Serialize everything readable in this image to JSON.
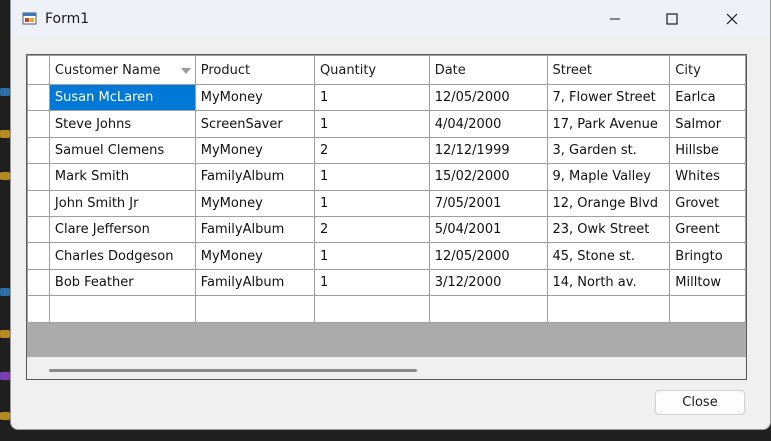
{
  "window": {
    "title": "Form1",
    "close_button_label": "Close"
  },
  "grid": {
    "columns": [
      "Customer Name",
      "Product",
      "Quantity",
      "Date",
      "Street",
      "City"
    ],
    "rows": [
      [
        "Susan McLaren",
        "MyMoney",
        "1",
        "12/05/2000",
        "7, Flower Street",
        "Earlca"
      ],
      [
        "Steve Johns",
        "ScreenSaver",
        "1",
        "4/04/2000",
        "17, Park Avenue",
        "Salmor"
      ],
      [
        "Samuel Clemens",
        "MyMoney",
        "2",
        "12/12/1999",
        "3, Garden st.",
        "Hillsbe"
      ],
      [
        "Mark Smith",
        "FamilyAlbum",
        "1",
        "15/02/2000",
        "9, Maple Valley",
        "Whites"
      ],
      [
        "John Smith Jr",
        "MyMoney",
        "1",
        "7/05/2001",
        "12, Orange Blvd",
        "Grovet"
      ],
      [
        "Clare Jefferson",
        "FamilyAlbum",
        "2",
        "5/04/2001",
        "23, Owk Street",
        "Greent"
      ],
      [
        "Charles Dodgeson",
        "MyMoney",
        "1",
        "12/05/2000",
        "45, Stone st.",
        "Bringto"
      ],
      [
        "Bob Feather",
        "FamilyAlbum",
        "1",
        "3/12/2000",
        "14, North av.",
        "Milltow"
      ]
    ],
    "selected_cell": {
      "row": 0,
      "col": 0
    },
    "colors": {
      "selection": "#0078d7",
      "grid_line": "#a0a0a0",
      "empty_area": "#ababab"
    }
  },
  "icons": [
    "app-form-icon",
    "minimize-icon",
    "maximize-icon",
    "close-icon",
    "sort-arrow-icon"
  ]
}
